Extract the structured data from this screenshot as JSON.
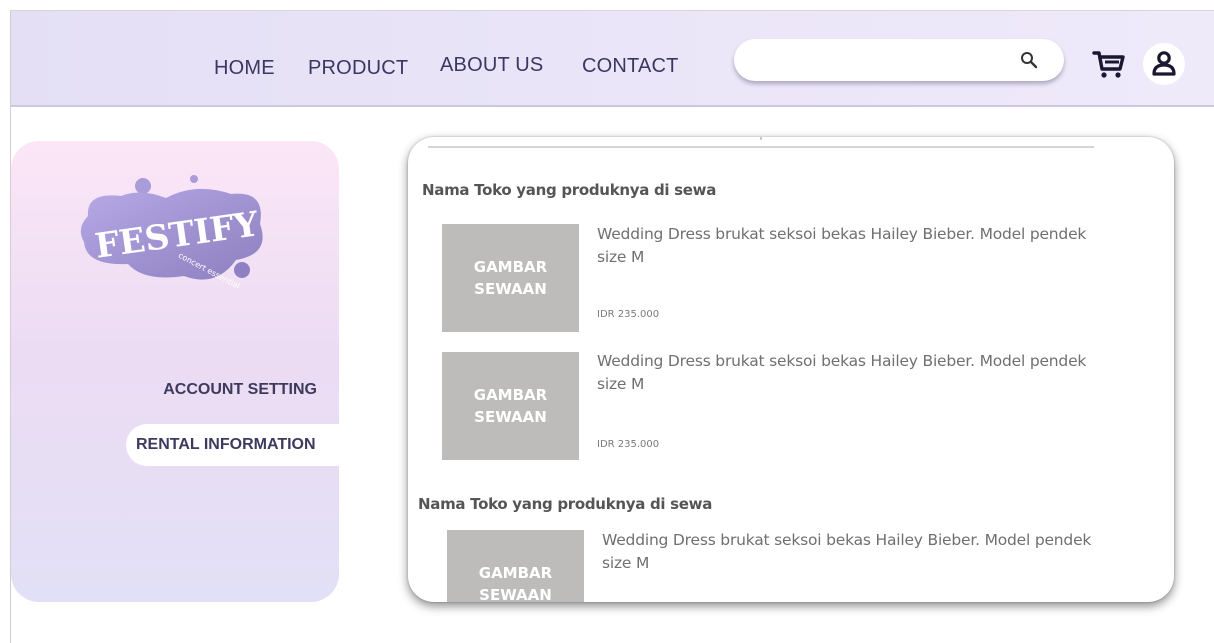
{
  "nav": {
    "home": "HOME",
    "product": "PRODUCT",
    "about": "ABOUT US",
    "contact": "CONTACT"
  },
  "search": {
    "placeholder": "",
    "value": ""
  },
  "icons": {
    "search": "search-icon",
    "cart": "cart-icon",
    "user": "user-icon",
    "logo": "festify-logo"
  },
  "logo": {
    "text": "FESTIFY",
    "tagline": "concert essential"
  },
  "sidebar": {
    "account_setting": "ACCOUNT SETTING",
    "rental_information": "RENTAL INFORMATION"
  },
  "rentals": [
    {
      "store": "Nama Toko yang produknya di sewa",
      "items": [
        {
          "thumb_line1": "GAMBAR",
          "thumb_line2": "SEWAAN",
          "desc1": "Wedding Dress brukat seksoi bekas Hailey Bieber. Model pendek",
          "desc2": "size M",
          "price": "IDR 235.000"
        },
        {
          "thumb_line1": "GAMBAR",
          "thumb_line2": "SEWAAN",
          "desc1": "Wedding Dress brukat seksoi bekas Hailey Bieber. Model pendek",
          "desc2": "size M",
          "price": "IDR 235.000"
        }
      ]
    },
    {
      "store": "Nama Toko yang produknya di sewa",
      "items": [
        {
          "thumb_line1": "GAMBAR",
          "thumb_line2": "SEWAAN",
          "desc1": "Wedding Dress brukat seksoi bekas Hailey Bieber. Model pendek",
          "desc2": "size M"
        }
      ]
    }
  ],
  "colors": {
    "header_bg": "#e8e3f7",
    "nav_text": "#3a3762",
    "thumb_bg": "#bdbcbb",
    "logo_purple": "#8f80c4"
  }
}
